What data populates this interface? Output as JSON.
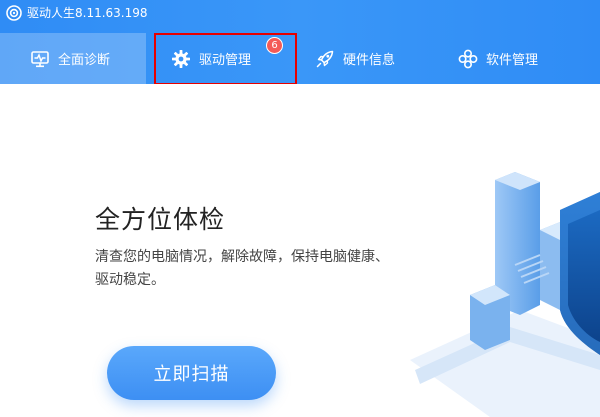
{
  "app": {
    "title": "驱动人生8.11.63.198"
  },
  "tabs": [
    {
      "label": "全面诊断",
      "icon": "monitor-icon",
      "active": true
    },
    {
      "label": "驱动管理",
      "icon": "gear-icon",
      "badge": "6",
      "highlighted": true
    },
    {
      "label": "硬件信息",
      "icon": "rocket-icon"
    },
    {
      "label": "软件管理",
      "icon": "apps-icon"
    }
  ],
  "hero": {
    "title": "全方位体检",
    "description": "清查您的电脑情况，解除故障，保持电脑健康、驱动稳定。",
    "button_label": "立即扫描"
  },
  "colors": {
    "header_blue": "#2f8cf5",
    "accent_blue": "#3d8ff3",
    "badge_red": "#f45b57",
    "highlight_red": "#e60000"
  }
}
